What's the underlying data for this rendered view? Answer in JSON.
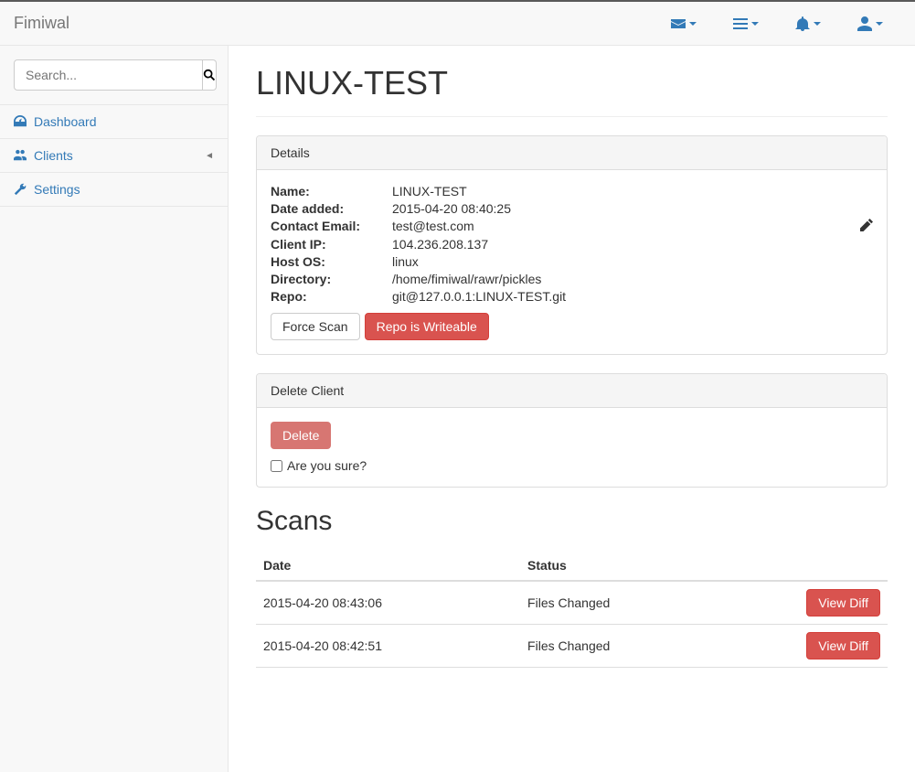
{
  "brand": "Fimiwal",
  "search": {
    "placeholder": "Search..."
  },
  "sidebar": {
    "items": [
      {
        "label": "Dashboard",
        "icon": "dashboard-icon"
      },
      {
        "label": "Clients",
        "icon": "users-icon",
        "expandable": true
      },
      {
        "label": "Settings",
        "icon": "wrench-icon"
      }
    ]
  },
  "page": {
    "title": "LINUX-TEST"
  },
  "details": {
    "heading": "Details",
    "labels": {
      "name": "Name:",
      "date_added": "Date added:",
      "contact_email": "Contact Email:",
      "client_ip": "Client IP:",
      "host_os": "Host OS:",
      "directory": "Directory:",
      "repo": "Repo:"
    },
    "values": {
      "name": "LINUX-TEST",
      "date_added": "2015-04-20 08:40:25",
      "contact_email": "test@test.com",
      "client_ip": "104.236.208.137",
      "host_os": "linux",
      "directory": "/home/fimiwal/rawr/pickles",
      "repo": "git@127.0.0.1:LINUX-TEST.git"
    },
    "buttons": {
      "force_scan": "Force Scan",
      "repo_writeable": "Repo is Writeable"
    }
  },
  "delete_panel": {
    "heading": "Delete Client",
    "button": "Delete",
    "confirm_label": "Are you sure?"
  },
  "scans": {
    "heading": "Scans",
    "columns": {
      "date": "Date",
      "status": "Status"
    },
    "rows": [
      {
        "date": "2015-04-20 08:43:06",
        "status": "Files Changed",
        "action": "View Diff"
      },
      {
        "date": "2015-04-20 08:42:51",
        "status": "Files Changed",
        "action": "View Diff"
      }
    ]
  }
}
